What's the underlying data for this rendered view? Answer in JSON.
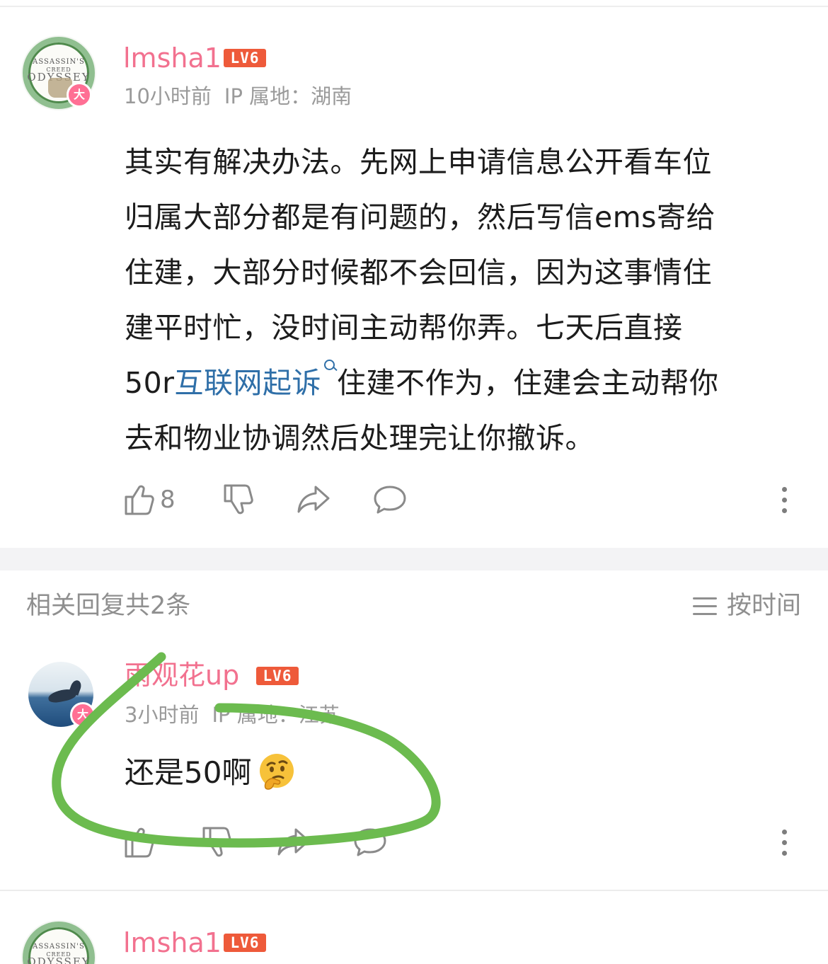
{
  "comment": {
    "username": "lmsha1",
    "level": "LV6",
    "vip_badge": "大",
    "time": "10小时前",
    "ip_location": "IP 属地：湖南",
    "body_lines": [
      "其实有解决办法。先网上申请信息公开看车位",
      "归属大部分都是有问题的，然后写信ems寄给",
      "住建，大部分时候都不会回信，因为这事情住",
      "建平时忙，没时间主动帮你弄。七天后直接"
    ],
    "line5_prefix": "50r",
    "search_link": "互联网起诉",
    "line5_suffix": "住建不作为，住建会主动帮你",
    "line6": "去和物业协调然后处理完让你撤诉。",
    "like_count": "8"
  },
  "replies_header": {
    "count_text": "相关回复共2条",
    "sort_label": "按时间"
  },
  "reply": {
    "username": "雨观花up",
    "level": "LV6",
    "vip_badge": "大",
    "time": "3小时前",
    "ip_location": "IP 属地：江苏",
    "body": "还是50啊"
  },
  "next_comment": {
    "username": "lmsha1",
    "level": "LV6"
  },
  "avatar_text": {
    "line1": "ASSASSIN'S",
    "line2": "CREED",
    "line3": "ODYSSEY"
  },
  "colors": {
    "username": "#f2718f",
    "level_badge": "#ee5a3a",
    "link": "#2f6fa8",
    "annotation": "#6cbb4f"
  },
  "icons": [
    "thumbs-up-icon",
    "thumbs-down-icon",
    "share-icon",
    "comment-icon",
    "more-icon",
    "search-icon",
    "sort-icon"
  ]
}
